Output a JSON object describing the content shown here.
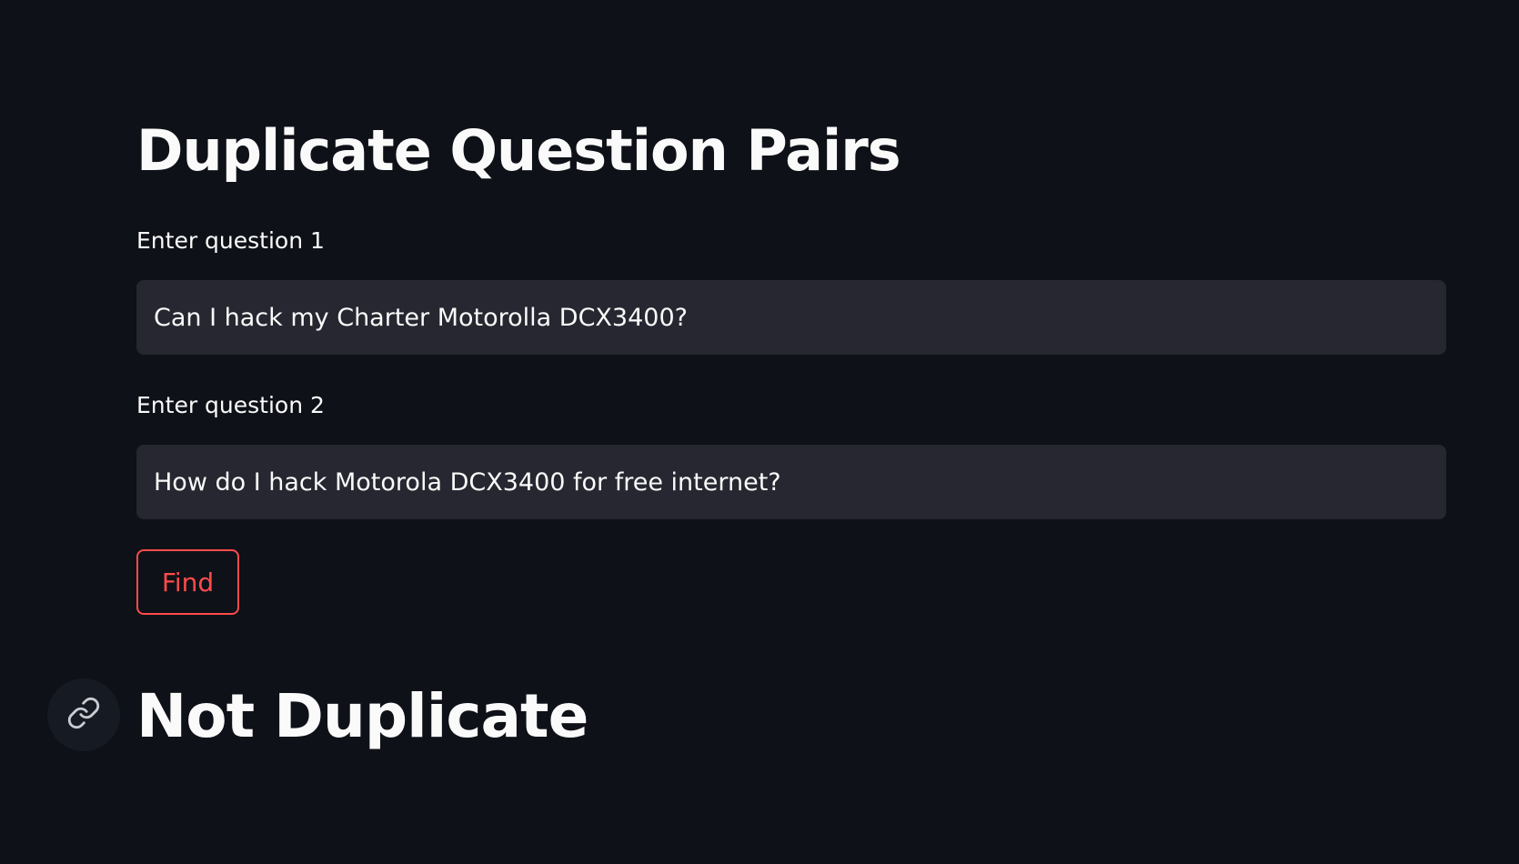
{
  "page": {
    "title": "Duplicate Question Pairs"
  },
  "form": {
    "question1": {
      "label": "Enter question 1",
      "value": "Can I hack my Charter Motorolla DCX3400?"
    },
    "question2": {
      "label": "Enter question 2",
      "value": "How do I hack Motorola DCX3400 for free internet?"
    },
    "find_label": "Find"
  },
  "result": {
    "text": "Not Duplicate",
    "anchor_icon": "link-icon"
  },
  "colors": {
    "background": "#0e1117",
    "input_background": "#262730",
    "accent": "#ff4b4b",
    "text": "#fafafa"
  }
}
